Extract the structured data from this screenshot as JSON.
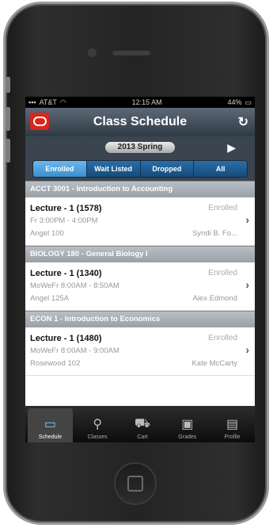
{
  "status_bar": {
    "carrier": "AT&T",
    "time": "12:15 AM",
    "battery": "44%"
  },
  "header": {
    "title": "Class Schedule"
  },
  "term": {
    "selected": "2013 Spring"
  },
  "segments": [
    {
      "label": "Enrolled",
      "active": true
    },
    {
      "label": "Wait Listed",
      "active": false
    },
    {
      "label": "Dropped",
      "active": false
    },
    {
      "label": "All",
      "active": false
    }
  ],
  "courses": [
    {
      "header": "ACCT 3001 - Introduction to Accounting",
      "lecture": "Lecture - 1 (1578)",
      "status": "Enrolled",
      "time": "Fr 3:00PM - 4:00PM",
      "room": "Angel 100",
      "instructor": "Syndi B. Fo..."
    },
    {
      "header": "BIOLOGY 180 - General Biology I",
      "lecture": "Lecture - 1 (1340)",
      "status": "Enrolled",
      "time": "MoWeFr 8:00AM - 8:50AM",
      "room": "Angel 125A",
      "instructor": "Alex Edmond"
    },
    {
      "header": "ECON 1 - Introduction to Economics",
      "lecture": "Lecture - 1 (1480)",
      "status": "Enrolled",
      "time": "MoWeFr 8:00AM - 9:00AM",
      "room": "Rosewood 102",
      "instructor": "Kate McCarty"
    }
  ],
  "tabs": [
    {
      "label": "Schedule",
      "icon": "schedule-icon",
      "active": true
    },
    {
      "label": "Classes",
      "icon": "search-icon",
      "active": false
    },
    {
      "label": "Cart",
      "icon": "cart-icon",
      "active": false
    },
    {
      "label": "Grades",
      "icon": "grades-icon",
      "active": false
    },
    {
      "label": "Profile",
      "icon": "profile-icon",
      "active": false
    }
  ]
}
